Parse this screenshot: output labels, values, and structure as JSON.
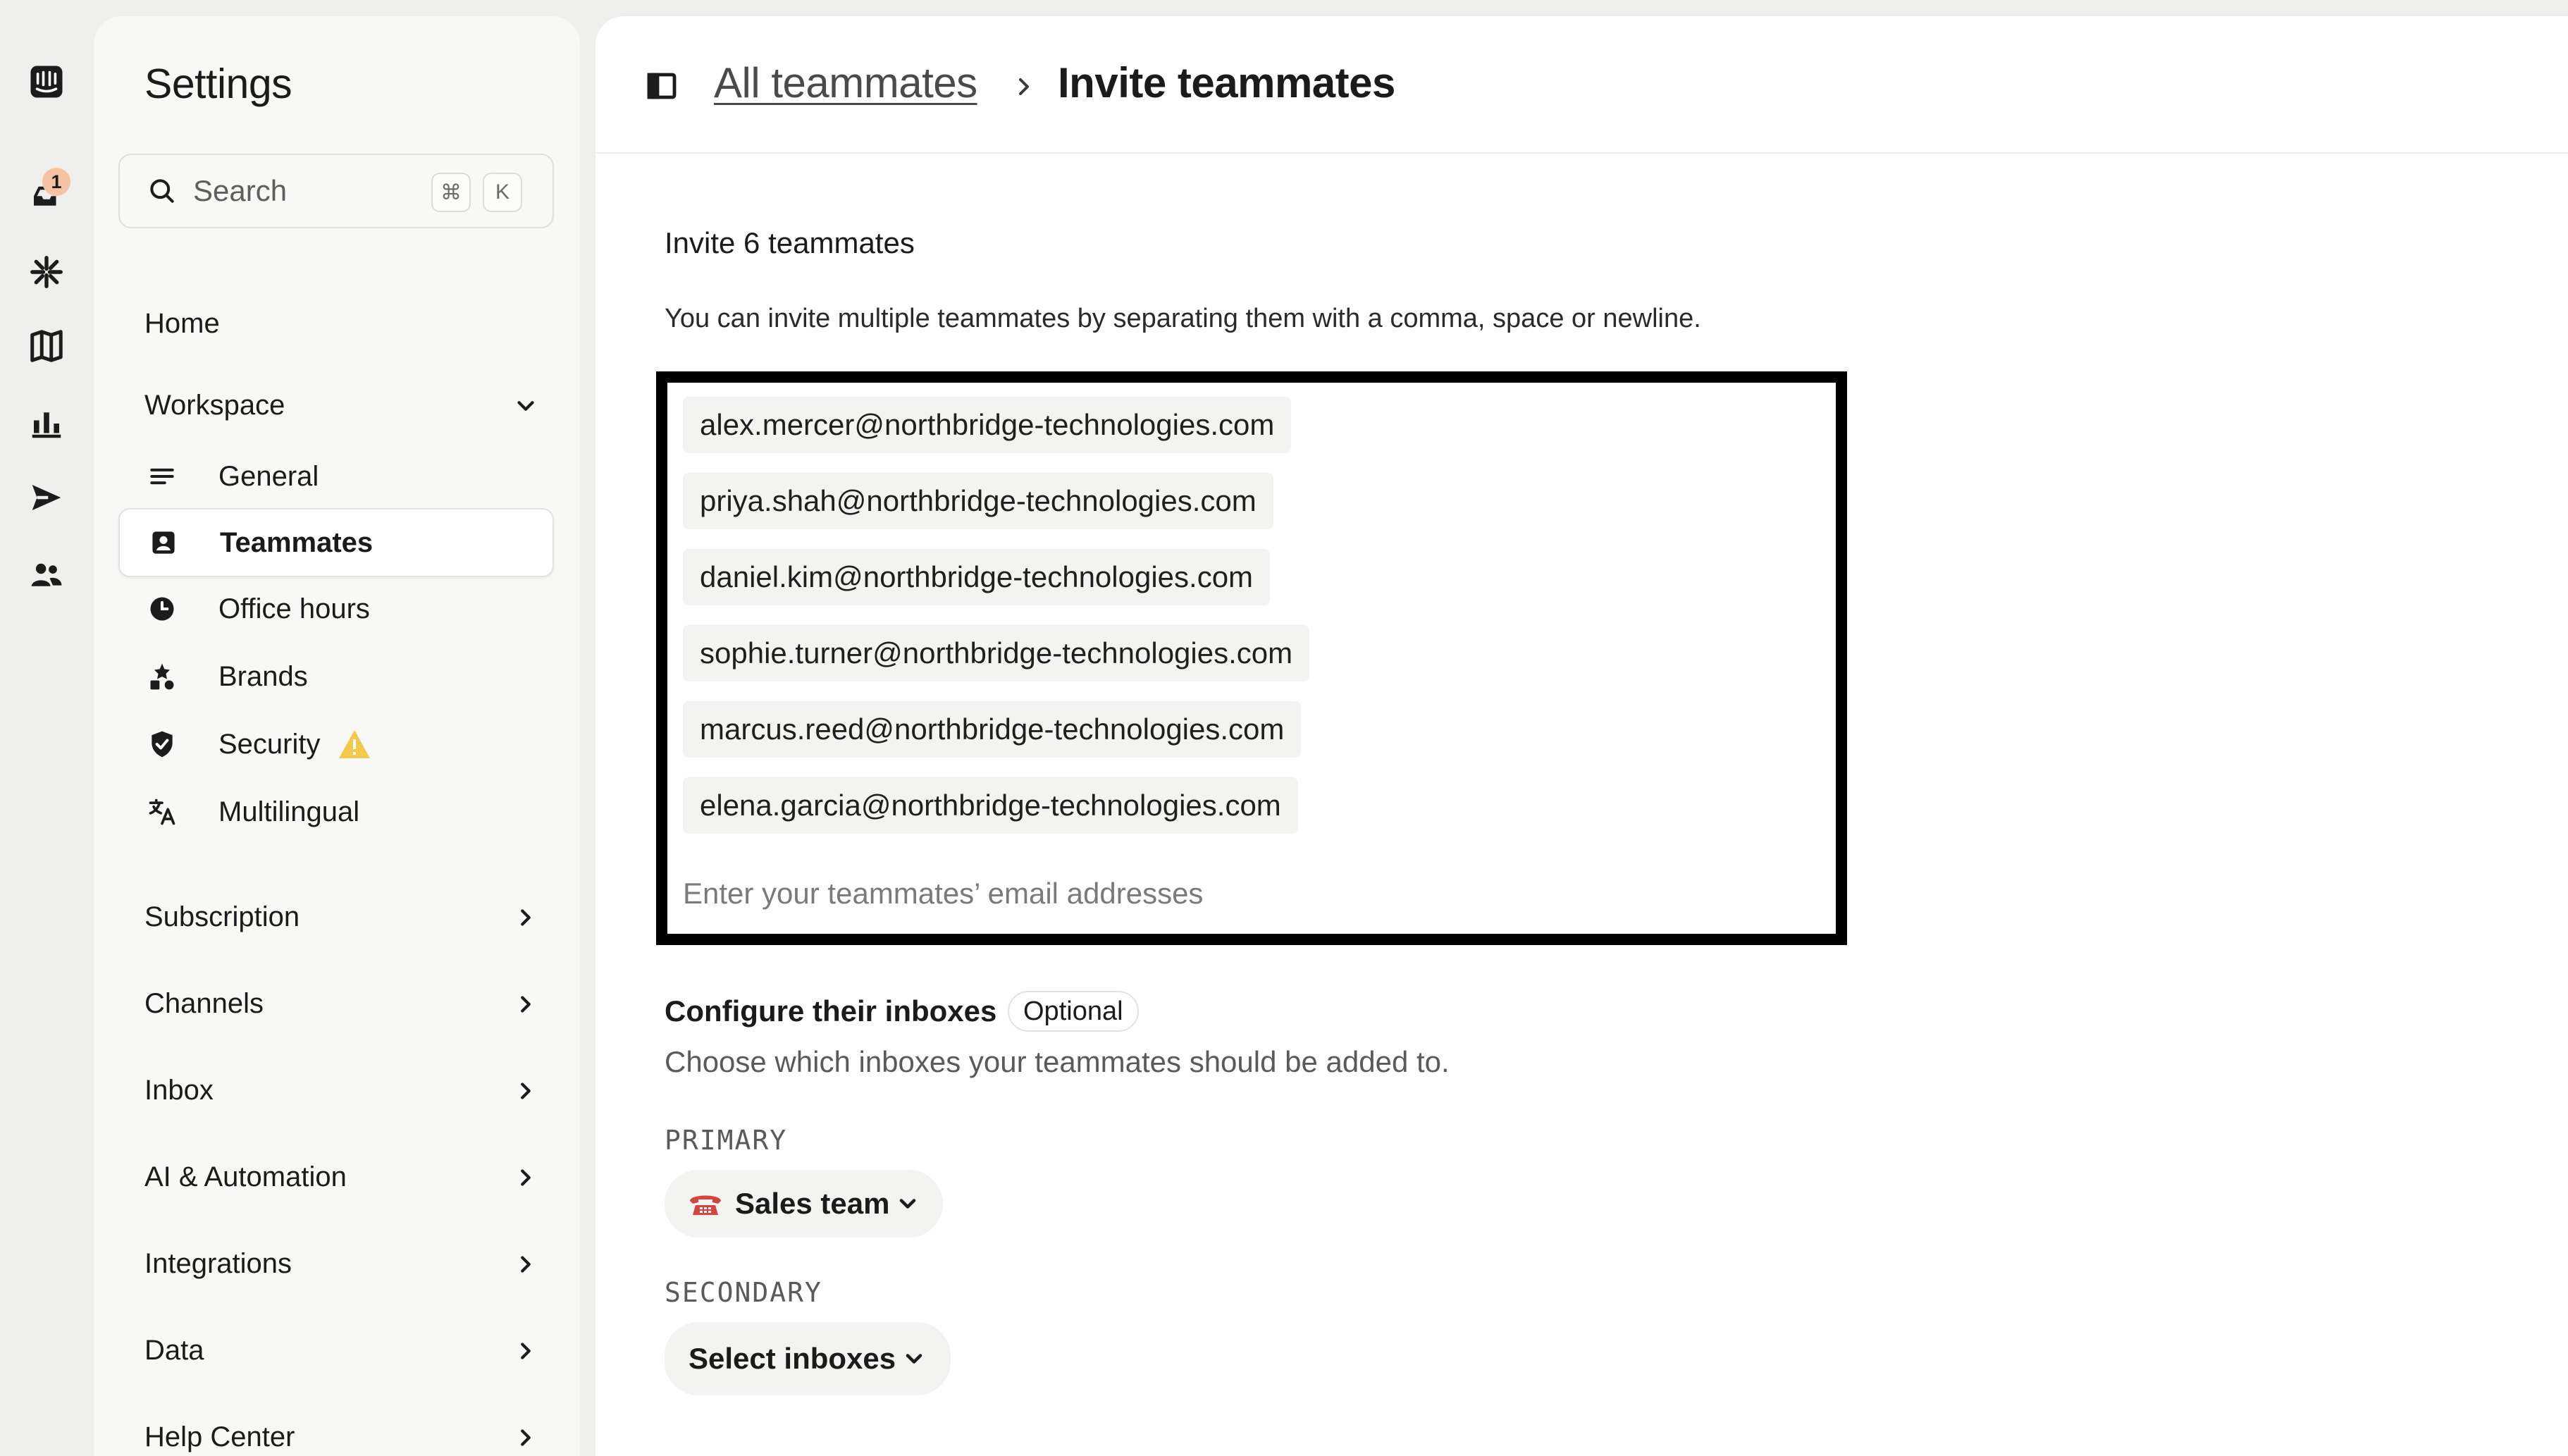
{
  "rail": {
    "inbox_badge": "1",
    "icons": [
      "intercom-logo-icon",
      "inbox-icon",
      "fin-ai-icon",
      "knowledge-book-icon",
      "reports-chart-icon",
      "outbound-send-icon",
      "contacts-people-icon"
    ]
  },
  "settings": {
    "title": "Settings",
    "search": {
      "placeholder": "Search",
      "shortcut_cmd": "⌘",
      "shortcut_key": "K"
    },
    "home": "Home",
    "workspace": {
      "label": "Workspace",
      "items": [
        {
          "label": "General",
          "icon": "lines-icon"
        },
        {
          "label": "Teammates",
          "icon": "person-badge-icon",
          "active": true
        },
        {
          "label": "Office hours",
          "icon": "clock-icon"
        },
        {
          "label": "Brands",
          "icon": "shapes-icon"
        },
        {
          "label": "Security",
          "icon": "shield-check-icon",
          "warning": true
        },
        {
          "label": "Multilingual",
          "icon": "translate-icon"
        }
      ]
    },
    "sections": [
      "Subscription",
      "Channels",
      "Inbox",
      "AI & Automation",
      "Integrations",
      "Data",
      "Help Center"
    ]
  },
  "breadcrumb": {
    "parent": "All teammates",
    "current": "Invite teammates"
  },
  "invite": {
    "title": "Invite 6 teammates",
    "help": "You can invite multiple teammates by separating them with a comma, space or newline.",
    "emails": [
      "alex.mercer@northbridge-technologies.com",
      "priya.shah@northbridge-technologies.com",
      "daniel.kim@northbridge-technologies.com",
      "sophie.turner@northbridge-technologies.com",
      "marcus.reed@northbridge-technologies.com",
      "elena.garcia@northbridge-technologies.com"
    ],
    "placeholder": "Enter your teammates’ email addresses"
  },
  "configure": {
    "title": "Configure their inboxes",
    "optional": "Optional",
    "help": "Choose which inboxes your teammates should be added to.",
    "primary_label": "PRIMARY",
    "primary_value": "Sales team",
    "secondary_label": "SECONDARY",
    "secondary_value": "Select inboxes"
  },
  "colors": {
    "warning": "#f2c94c",
    "phone_red": "#d6453d",
    "badge": "#f7c2a4"
  }
}
